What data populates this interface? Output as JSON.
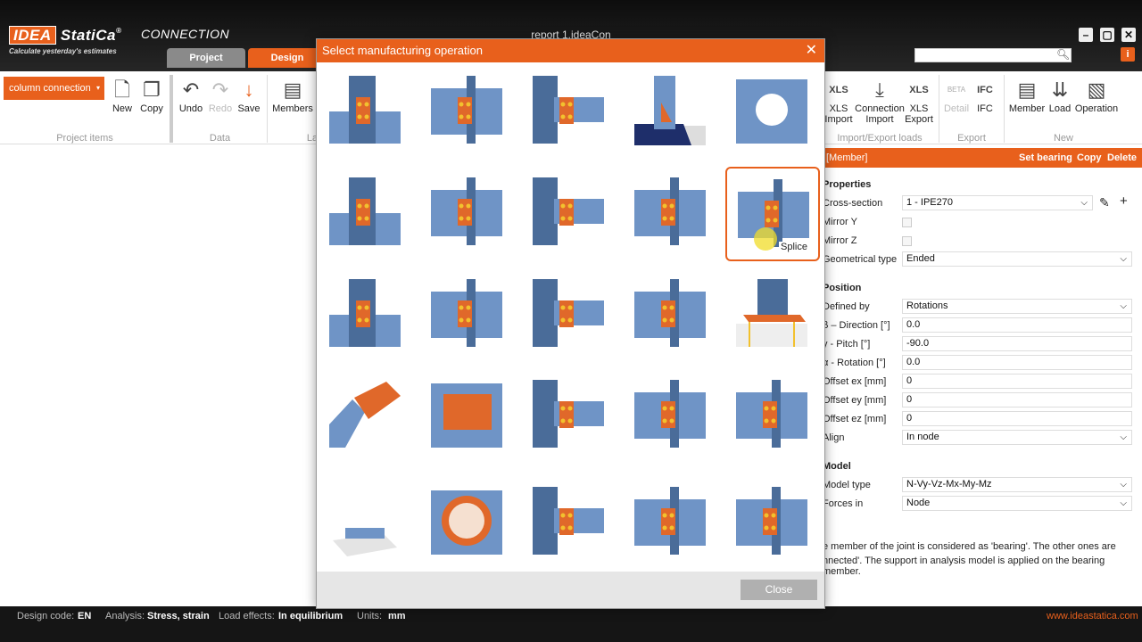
{
  "app": {
    "logo_idea": "IDEA",
    "logo_statica": "StatiCa",
    "logo_reg": "®",
    "logo_module": "CONNECTION",
    "tagline": "Calculate yesterday's estimates",
    "window_title": "report 1.ideaCon",
    "min": "–",
    "max": "▢",
    "close": "✕"
  },
  "tabs": [
    {
      "label": "Project",
      "active": false
    },
    {
      "label": "Design",
      "active": true
    }
  ],
  "search": {
    "icon": "search-icon",
    "placeholder": ""
  },
  "info_glyph": "i",
  "ribbon": {
    "project_select": "column connection",
    "project_select_arrow": "▾",
    "new": "New",
    "copy": "Copy",
    "undo": "Undo",
    "redo": "Redo",
    "save": "Save",
    "members": "Members",
    "group_project_items": "Project items",
    "group_data": "Data",
    "group_la": "La",
    "xls_import_1": "XLS",
    "xls_import_2": "Import",
    "conn_import_1": "Connection",
    "conn_import_2": "Import",
    "xls_export_1": "XLS",
    "xls_export_2": "Export",
    "group_import_export": "Import/Export loads",
    "detail": "Detail",
    "beta": "BETA",
    "ifc": "IFC",
    "group_export": "Export",
    "member": "Member",
    "load": "Load",
    "operation": "Operation",
    "group_new": "New",
    "icon_xls": "XLS",
    "icon_ifc": "IFC"
  },
  "props": {
    "header_title": "[Member]",
    "set_bearing": "Set bearing",
    "copy": "Copy",
    "delete": "Delete",
    "sec_properties": "Properties",
    "cross_section_label": "Cross-section",
    "cross_section_value": "1 - IPE270",
    "mirror_y": "Mirror Y",
    "mirror_z": "Mirror Z",
    "geom_type_label": "Geometrical type",
    "geom_type_value": "Ended",
    "sec_position": "Position",
    "defined_by_label": "Defined by",
    "defined_by_value": "Rotations",
    "direction_label": "β – Direction [°]",
    "direction_value": "0.0",
    "pitch_label": "γ - Pitch [°]",
    "pitch_value": "-90.0",
    "rotation_label": "α - Rotation [°]",
    "rotation_value": "0.0",
    "offset_ex_label": "Offset ex [mm]",
    "offset_ex_value": "0",
    "offset_ey_label": "Offset ey [mm]",
    "offset_ey_value": "0",
    "offset_ez_label": "Offset ez [mm]",
    "offset_ez_value": "0",
    "align_label": "Align",
    "align_value": "In node",
    "sec_model": "Model",
    "model_type_label": "Model type",
    "model_type_value": "N-Vy-Vz-Mx-My-Mz",
    "forces_in_label": "Forces in",
    "forces_in_value": "Node",
    "note_line1": "e member of the joint is considered as 'bearing'. The other ones are",
    "note_line2": "nnected'. The support in analysis model is applied on the bearing member."
  },
  "dialog": {
    "title": "Select manufacturing operation",
    "close_x": "✕",
    "close_button": "Close",
    "tooltip": "Splice",
    "operations": [
      "stiffener-plate",
      "rib",
      "haunch",
      "base-plate",
      "opening",
      "end-plate",
      "cleat-end-plate",
      "web-cleat",
      "fin-plate",
      "splice",
      "gusset-plate",
      "bolted-bracket",
      "plate-to-plate",
      "cleat-connection",
      "column-base",
      "bent-member",
      "cover-plate",
      "seat-plate",
      "bolted-flange-plate",
      "welded-plate",
      "anchoring",
      "tube-opening",
      "cut-member",
      "truss-node",
      "bolted-stub"
    ],
    "selected_index": 9
  },
  "status": {
    "design_code_label": "Design code:",
    "design_code_value": "EN",
    "analysis_label": "Analysis:",
    "analysis_value": "Stress, strain",
    "load_effects_label": "Load effects:",
    "load_effects_value": "In equilibrium",
    "units_label": "Units:",
    "units_value": "mm",
    "website": "www.ideastatica.com"
  },
  "colors": {
    "accent": "#e8601c",
    "steel": "#6f94c6",
    "plate": "#e0682a",
    "bolt": "#f2c12e"
  }
}
